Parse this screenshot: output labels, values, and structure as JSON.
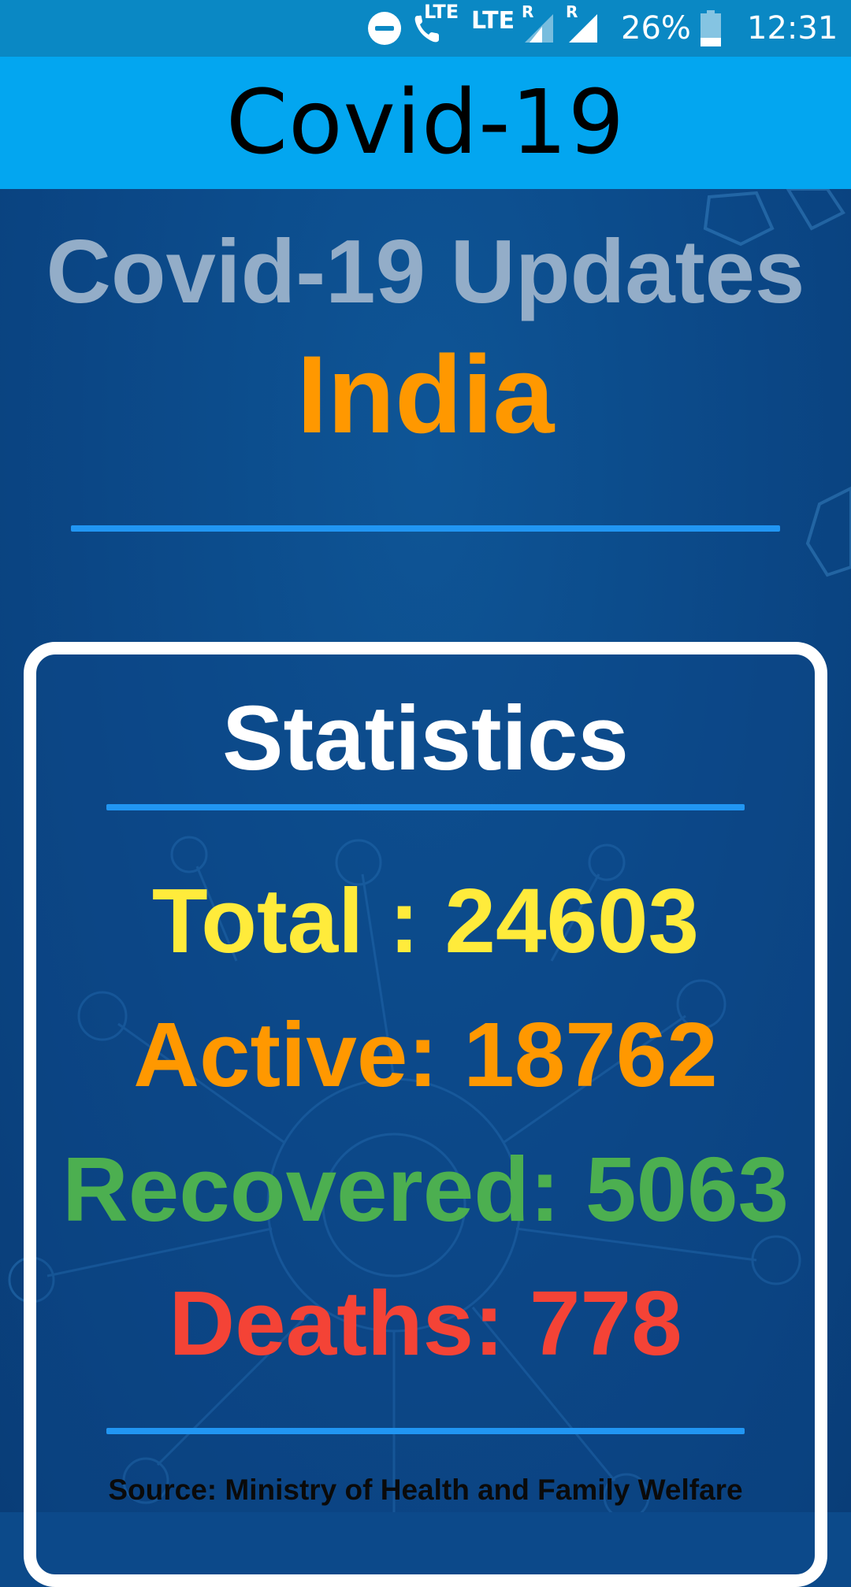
{
  "status_bar": {
    "lte_call_label": "LTE",
    "lte_data_label": "LTE",
    "roaming_label_1": "R",
    "roaming_label_2": "R",
    "battery_percent": "26%",
    "battery_level": 0.26,
    "time": "12:31"
  },
  "app_bar": {
    "title": "Covid-19"
  },
  "header": {
    "title": "Covid-19 Updates",
    "country": "India"
  },
  "statistics": {
    "title": "Statistics",
    "total": "Total : 24603",
    "active": "Active: 18762",
    "recovered": "Recovered: 5063",
    "deaths": "Deaths: 778",
    "source": "Source: Ministry of Health and Family Welfare"
  },
  "colors": {
    "app_bar": "#03a6f0",
    "status_bar": "#0a88c4",
    "background": "#0b4786",
    "accent_divider": "#2196f3",
    "header_title": "#93adc8",
    "country": "#ff9800",
    "total": "#ffeb3b",
    "active": "#ff9800",
    "recovered": "#4caf50",
    "deaths": "#f44336"
  }
}
